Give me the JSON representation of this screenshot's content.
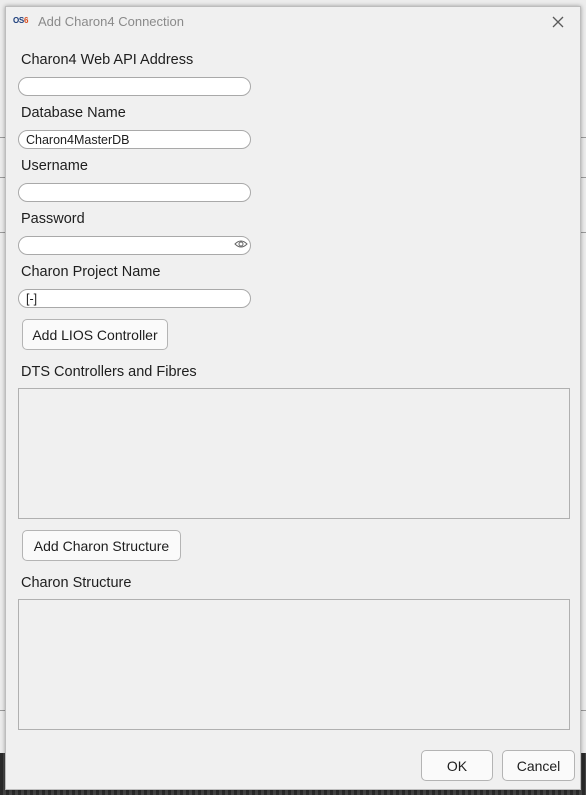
{
  "window": {
    "app_icon_text_main": "OS",
    "app_icon_text_accent": "6",
    "title": "Add Charon4 Connection"
  },
  "form": {
    "web_api_label": "Charon4 Web API Address",
    "web_api_value": "",
    "database_label": "Database Name",
    "database_value": "Charon4MasterDB",
    "username_label": "Username",
    "username_value": "",
    "password_label": "Password",
    "password_value": "",
    "project_label": "Charon Project Name",
    "project_value": "[-]"
  },
  "buttons": {
    "add_lios": "Add LIOS Controller",
    "add_structure": "Add Charon Structure",
    "ok": "OK",
    "cancel": "Cancel"
  },
  "sections": {
    "dts_label": "DTS Controllers and Fibres",
    "structure_label": "Charon Structure"
  },
  "colors": {
    "dialog_bg": "#f0f0f0",
    "icon_blue": "#1a3c7a",
    "icon_orange": "#d84a1b"
  },
  "icons": {
    "close": "close-icon",
    "password_reveal": "eye-icon"
  }
}
